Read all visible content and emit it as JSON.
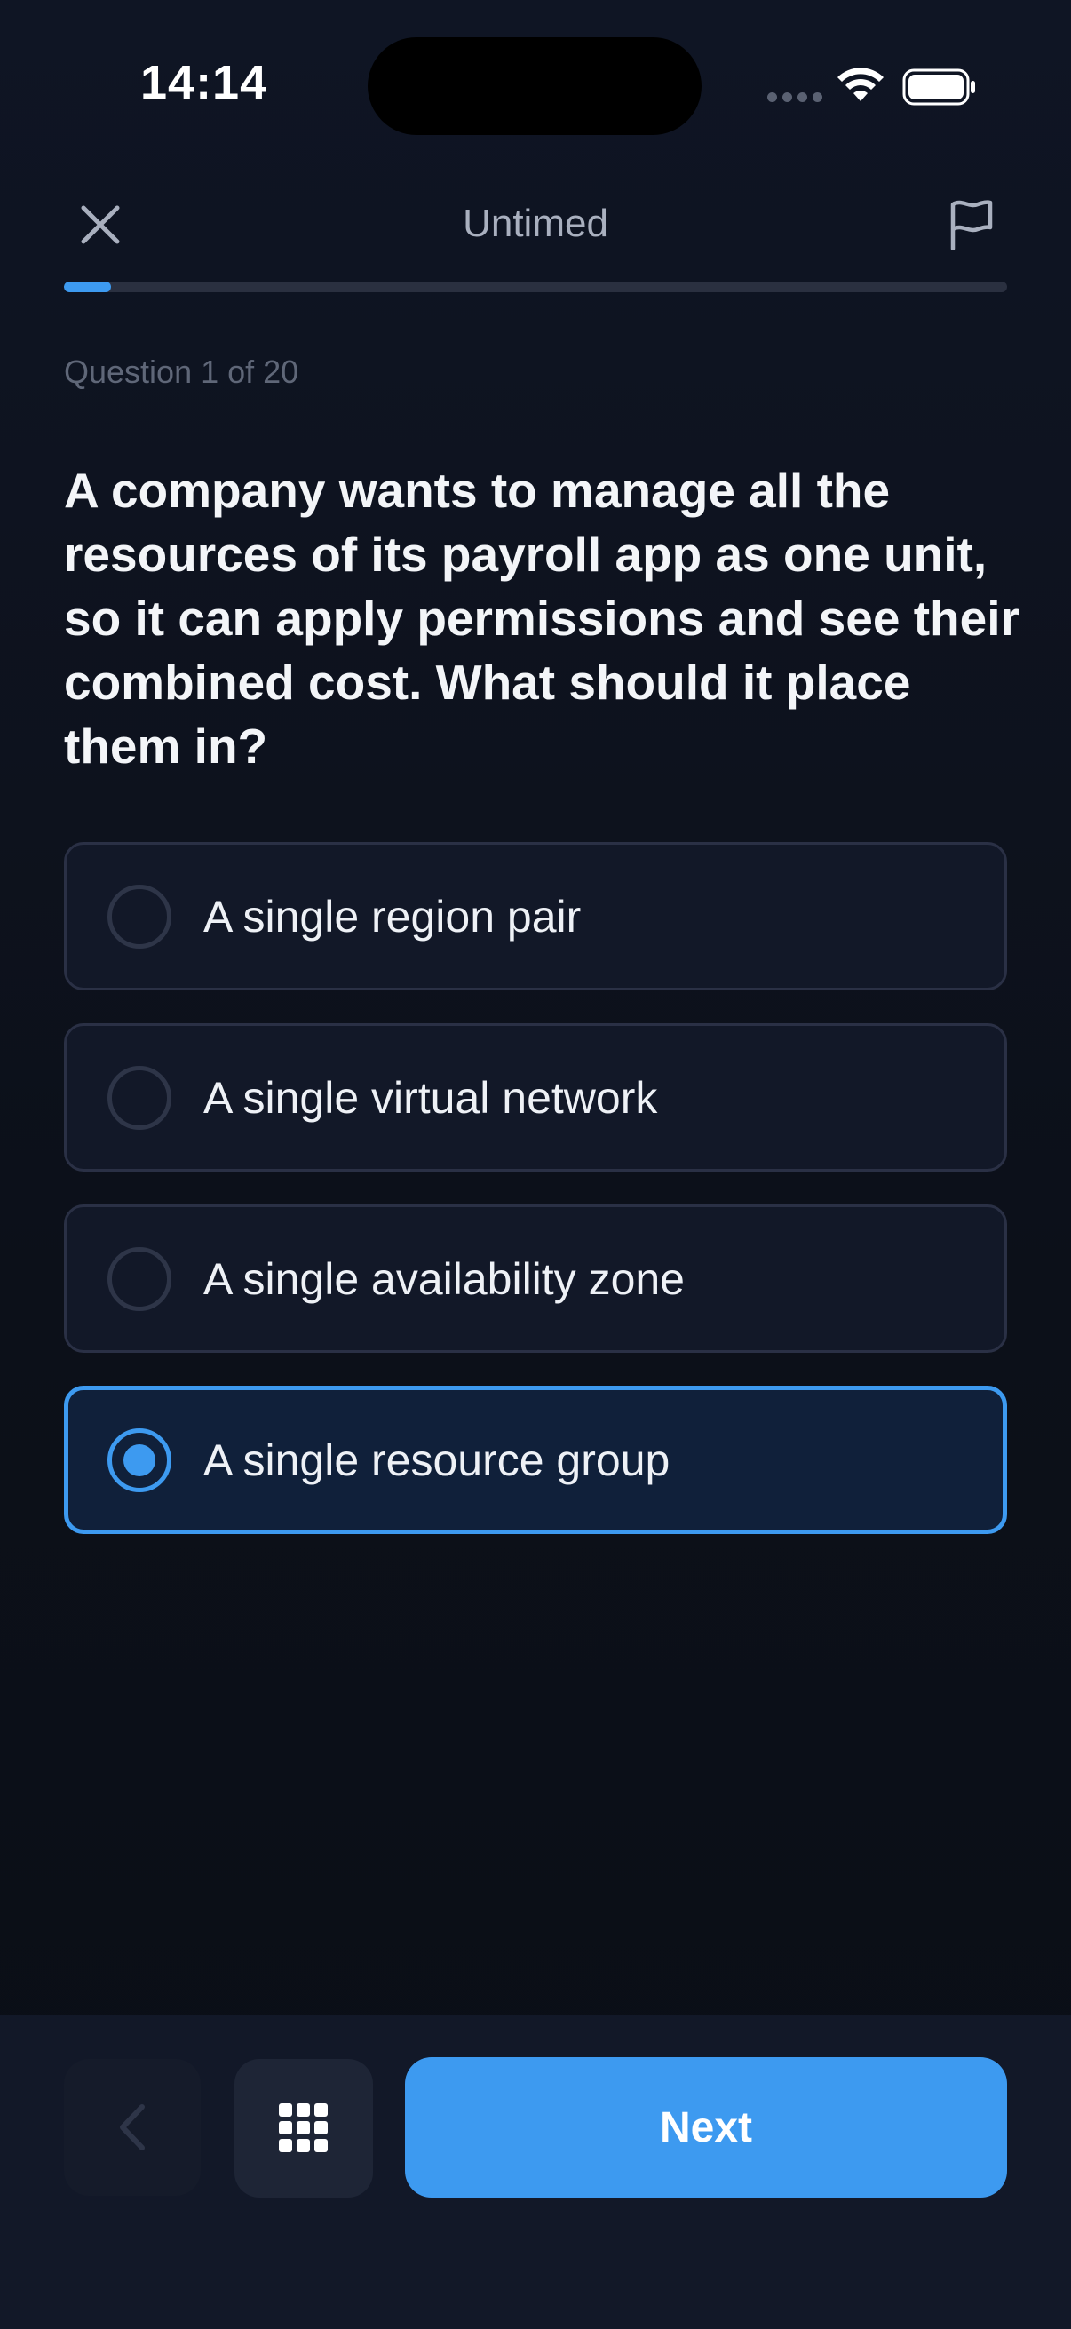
{
  "status_bar": {
    "time": "14:14"
  },
  "header": {
    "mode": "Untimed",
    "close_icon": "close-icon",
    "flag_icon": "flag-icon",
    "progress_fraction": 0.05
  },
  "question": {
    "counter": "Question 1 of 20",
    "text": "A company wants to manage all the resources of its payroll app as one unit, so it can apply permissions and see their combined cost. What should it place them in?"
  },
  "options": [
    {
      "label": "A single region pair",
      "selected": false
    },
    {
      "label": "A single virtual network",
      "selected": false
    },
    {
      "label": "A single availability zone",
      "selected": false
    },
    {
      "label": "A single resource group",
      "selected": true
    }
  ],
  "footer": {
    "prev_icon": "chevron-left-icon",
    "grid_icon": "grid-icon",
    "next_label": "Next"
  },
  "colors": {
    "accent": "#3d9af0",
    "background": "#0c1019",
    "option_border": "#2a3045"
  }
}
